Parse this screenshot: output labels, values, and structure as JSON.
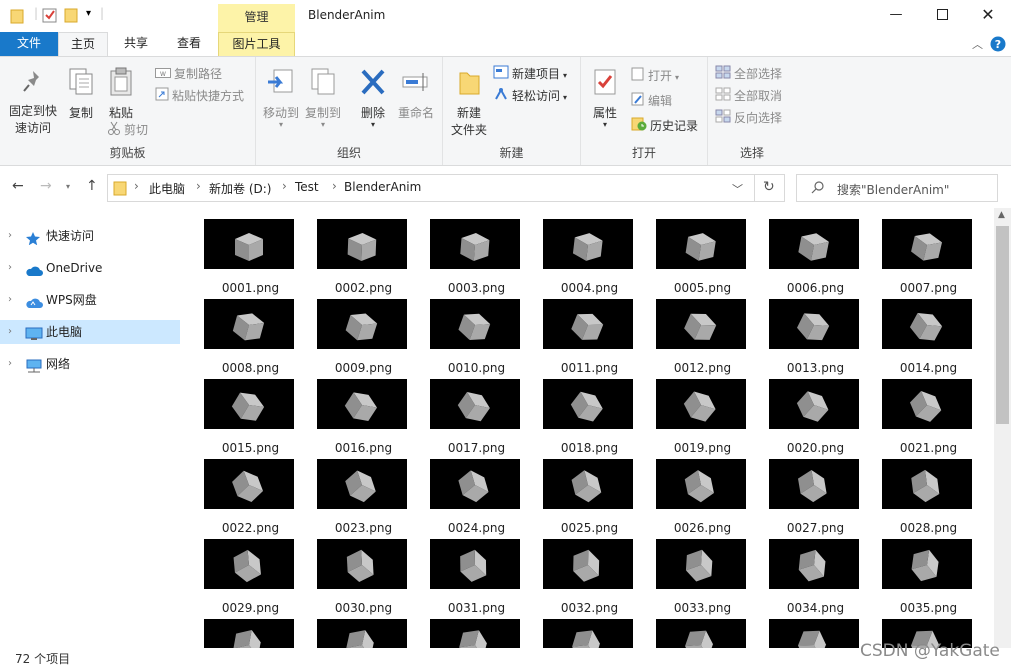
{
  "window": {
    "context_tab_header": "管理",
    "title": "BlenderAnim",
    "minimize_icon": "minimize-icon",
    "maximize_icon": "maximize-icon",
    "close_icon": "close-icon"
  },
  "tabs": {
    "file": "文件",
    "home": "主页",
    "share": "共享",
    "view": "查看",
    "picture_tools": "图片工具"
  },
  "ribbon": {
    "clipboard": {
      "label": "剪贴板",
      "pin": "固定到快\n速访问",
      "copy": "复制",
      "paste": "粘贴",
      "copy_path": "复制路径",
      "paste_shortcut": "粘贴快捷方式",
      "cut": "剪切"
    },
    "organize": {
      "label": "组织",
      "move_to": "移动到",
      "copy_to": "复制到",
      "delete": "删除",
      "rename": "重命名"
    },
    "new": {
      "label": "新建",
      "new_folder": "新建\n文件夹",
      "new_item": "新建项目",
      "easy_access": "轻松访问"
    },
    "open": {
      "label": "打开",
      "properties": "属性",
      "open": "打开",
      "edit": "编辑",
      "history": "历史记录"
    },
    "select": {
      "label": "选择",
      "select_all": "全部选择",
      "select_none": "全部取消",
      "invert": "反向选择"
    }
  },
  "address": {
    "crumbs": [
      "此电脑",
      "新加卷 (D:)",
      "Test",
      "BlenderAnim"
    ],
    "search_placeholder": "搜索\"BlenderAnim\""
  },
  "sidebar": {
    "items": [
      {
        "label": "快速访问",
        "icon": "star-icon"
      },
      {
        "label": "OneDrive",
        "icon": "cloud-icon"
      },
      {
        "label": "WPS网盘",
        "icon": "wps-cloud-icon"
      },
      {
        "label": "此电脑",
        "icon": "computer-icon"
      },
      {
        "label": "网络",
        "icon": "network-icon"
      }
    ]
  },
  "files": {
    "items": [
      "0001.png",
      "0002.png",
      "0003.png",
      "0004.png",
      "0005.png",
      "0006.png",
      "0007.png",
      "0008.png",
      "0009.png",
      "0010.png",
      "0011.png",
      "0012.png",
      "0013.png",
      "0014.png",
      "0015.png",
      "0016.png",
      "0017.png",
      "0018.png",
      "0019.png",
      "0020.png",
      "0021.png",
      "0022.png",
      "0023.png",
      "0024.png",
      "0025.png",
      "0026.png",
      "0027.png",
      "0028.png",
      "0029.png",
      "0030.png",
      "0031.png",
      "0032.png",
      "0033.png",
      "0034.png",
      "0035.png"
    ]
  },
  "status": {
    "count": "72 个项目",
    "watermark": "CSDN @YakGate"
  },
  "colors": {
    "file_tab": "#1979ca",
    "context_tab": "#fdf3a8",
    "selected_nav": "#cce8ff"
  }
}
